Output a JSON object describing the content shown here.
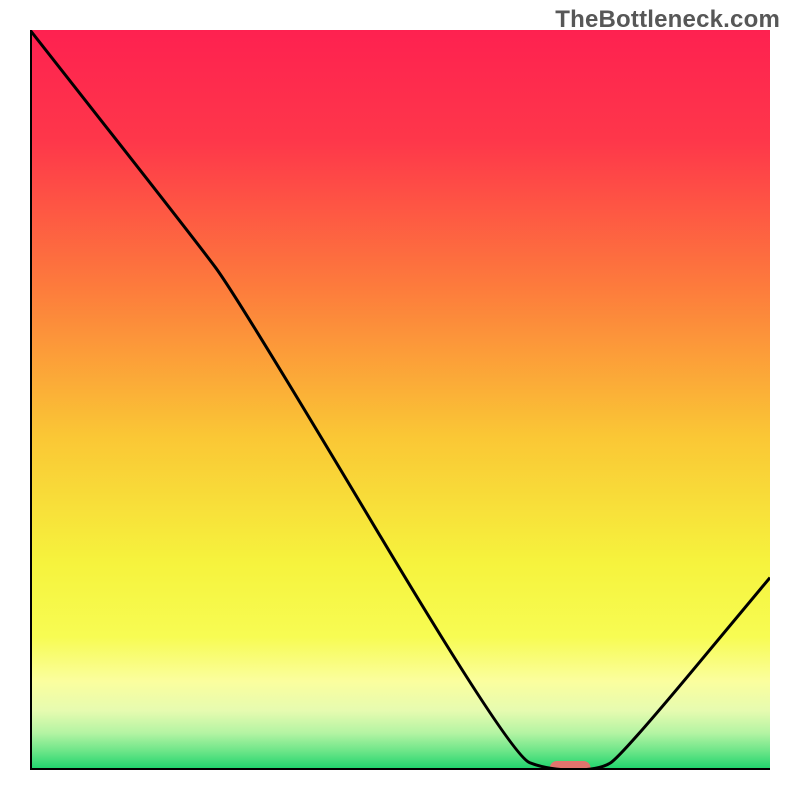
{
  "watermark": "TheBottleneck.com",
  "chart_data": {
    "type": "line",
    "title": "",
    "xlabel": "",
    "ylabel": "",
    "xlim": [
      0,
      100
    ],
    "ylim": [
      0,
      100
    ],
    "grid": false,
    "curve_points": [
      {
        "x": 0,
        "y": 100
      },
      {
        "x": 22,
        "y": 72
      },
      {
        "x": 28,
        "y": 64
      },
      {
        "x": 65,
        "y": 2
      },
      {
        "x": 70,
        "y": 0
      },
      {
        "x": 77,
        "y": 0
      },
      {
        "x": 80,
        "y": 2
      },
      {
        "x": 100,
        "y": 26
      }
    ],
    "marker": {
      "x": 73,
      "y": 0,
      "width_frac": 0.055,
      "color": "#e2746e"
    },
    "gradient_stops": [
      {
        "offset": 0.0,
        "color": "#fe2150"
      },
      {
        "offset": 0.15,
        "color": "#fe374a"
      },
      {
        "offset": 0.35,
        "color": "#fd7c3c"
      },
      {
        "offset": 0.55,
        "color": "#fac735"
      },
      {
        "offset": 0.72,
        "color": "#f6f33d"
      },
      {
        "offset": 0.82,
        "color": "#f7fc53"
      },
      {
        "offset": 0.88,
        "color": "#fbfe9e"
      },
      {
        "offset": 0.92,
        "color": "#e6fbb0"
      },
      {
        "offset": 0.95,
        "color": "#b4f4a3"
      },
      {
        "offset": 0.975,
        "color": "#6be588"
      },
      {
        "offset": 1.0,
        "color": "#1ad36b"
      }
    ],
    "axis_color": "#000000",
    "curve_color": "#000000"
  }
}
